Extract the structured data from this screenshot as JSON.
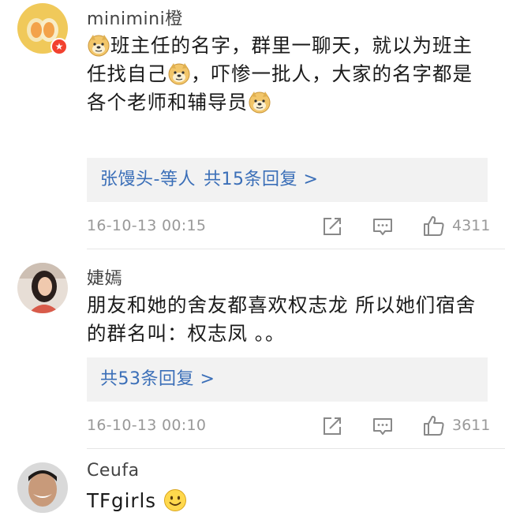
{
  "comments": [
    {
      "username": "minimini橙",
      "badge_icon": "star-badge-icon",
      "lines": [
        [
          "{doge}",
          "班主任的名字，群里一聊天，就以为班主"
        ],
        [
          "任找自己",
          "{doge}",
          "，吓惨一批人，大家的名字都是"
        ],
        [
          "各个老师和辅导员",
          "{doge}"
        ]
      ],
      "replies_users": "张馒头-等人",
      "replies_label": "共15条回复 >",
      "timestamp": "16-10-13 00:15",
      "likes": "4311"
    },
    {
      "username": "婕嫣",
      "lines": [
        [
          "朋友和她的舍友都喜欢权志龙 所以她们宿舍"
        ],
        [
          "的群名叫：权志凤 。。"
        ]
      ],
      "replies_users": "",
      "replies_label": "共53条回复 >",
      "timestamp": "16-10-13 00:10",
      "likes": "3611"
    },
    {
      "username": "Ceufa",
      "text": "TFgirls",
      "emoji": "smile-emoji-icon"
    }
  ],
  "icons": {
    "share": "share-icon",
    "comment": "comment-icon",
    "like": "thumbs-up-icon"
  },
  "colors": {
    "link": "#3b6fb8",
    "meta": "#999999",
    "reply_bg": "#f2f2f2",
    "badge": "#f2412f"
  }
}
